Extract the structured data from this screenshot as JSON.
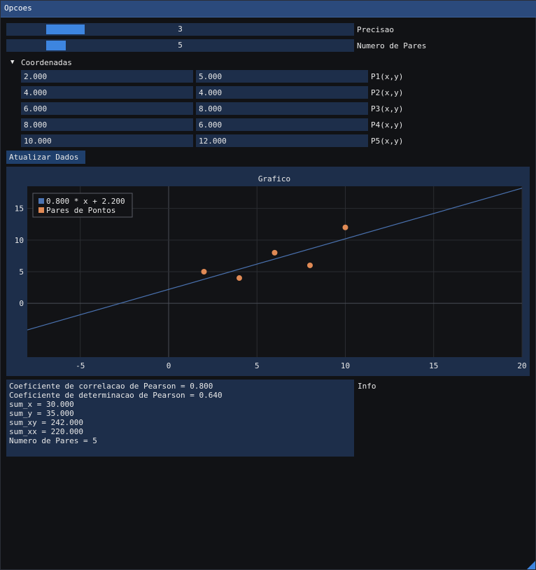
{
  "window": {
    "title": "Opcoes"
  },
  "precisao": {
    "value": 3,
    "fraction": 0.125,
    "label": "Precisao"
  },
  "numero_de_pares": {
    "value": 5,
    "fraction": 0.06,
    "label": "Numero de Pares"
  },
  "coordenadas": {
    "header": "Coordenadas",
    "rows": [
      {
        "x": "2.000",
        "y": "5.000",
        "label": "P1(x,y)"
      },
      {
        "x": "4.000",
        "y": "4.000",
        "label": "P2(x,y)"
      },
      {
        "x": "6.000",
        "y": "8.000",
        "label": "P3(x,y)"
      },
      {
        "x": "8.000",
        "y": "6.000",
        "label": "P4(x,y)"
      },
      {
        "x": "10.000",
        "y": "12.000",
        "label": "P5(x,y)"
      }
    ]
  },
  "atualizar_button": "Atualizar Dados",
  "chart_data": {
    "type": "scatter",
    "title": "Grafico",
    "xlim": [
      -8,
      20
    ],
    "ylim": [
      -8.5,
      18.5
    ],
    "xticks": [
      -5,
      0,
      5,
      10,
      15,
      20
    ],
    "yticks": [
      0,
      5,
      10,
      15
    ],
    "grid": true,
    "legend_position": "top-left",
    "series": [
      {
        "name": "0.800 * x + 2.200",
        "kind": "line",
        "slope": 0.8,
        "intercept": 2.2,
        "color": "#4a72b0"
      },
      {
        "name": "Pares de Pontos",
        "kind": "scatter",
        "color": "#e08a55",
        "x": [
          2,
          4,
          6,
          8,
          10
        ],
        "y": [
          5,
          4,
          8,
          6,
          12
        ]
      }
    ]
  },
  "info": {
    "label": "Info",
    "lines": [
      "Coeficiente de correlacao de Pearson = 0.800",
      "Coeficiente de determinacao de Pearson = 0.640",
      "sum_x = 30.000",
      "sum_y = 35.000",
      "sum_xy = 242.000",
      "sum_xx = 220.000",
      "Numero de Pares = 5"
    ]
  }
}
